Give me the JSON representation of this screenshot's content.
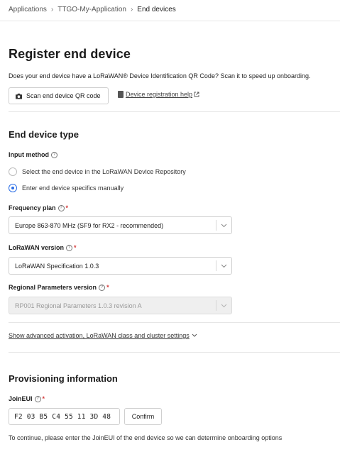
{
  "breadcrumb": {
    "items": [
      "Applications",
      "TTGO-My-Application",
      "End devices"
    ],
    "separator": "›"
  },
  "page": {
    "title": "Register end device",
    "intro": "Does your end device have a LoRaWAN® Device Identification QR Code? Scan it to speed up onboarding.",
    "scan_button": "Scan end device QR code",
    "help_link": "Device registration help"
  },
  "end_device_type": {
    "section_title": "End device type",
    "input_method_label": "Input method",
    "options": [
      {
        "label": "Select the end device in the LoRaWAN Device Repository",
        "checked": false
      },
      {
        "label": "Enter end device specifics manually",
        "checked": true
      }
    ],
    "frequency_plan": {
      "label": "Frequency plan",
      "value": "Europe 863-870 MHz (SF9 for RX2 - recommended)"
    },
    "lorawan_version": {
      "label": "LoRaWAN version",
      "value": "LoRaWAN Specification 1.0.3"
    },
    "regional_parameters": {
      "label": "Regional Parameters version",
      "value": "RP001 Regional Parameters 1.0.3 revision A",
      "disabled": true
    },
    "advanced_link": "Show advanced activation, LoRaWAN class and cluster settings"
  },
  "provisioning": {
    "section_title": "Provisioning information",
    "joineui_label": "JoinEUI",
    "joineui_value": "F2 03 B5 C4 55 11 3D 48",
    "confirm_button": "Confirm",
    "note": "To continue, please enter the JoinEUI of the end device so we can determine onboarding options"
  },
  "colors": {
    "accent": "#2b6ee6",
    "required": "#d43b3b",
    "border": "#cfcfcf"
  }
}
